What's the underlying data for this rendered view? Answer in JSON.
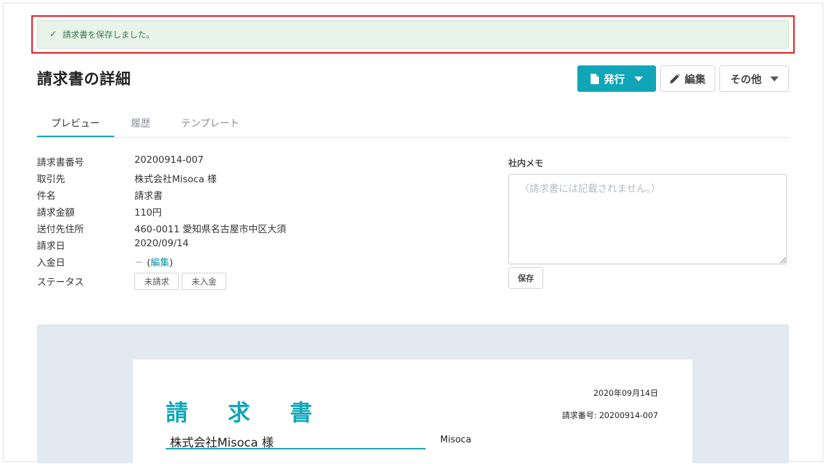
{
  "alert": {
    "icon": "check-icon",
    "message": "請求書を保存しました。"
  },
  "page": {
    "title": "請求書の詳細"
  },
  "toolbar": {
    "issue_label": "発行",
    "issue_icon": "document-icon",
    "edit_label": "編集",
    "edit_icon": "pencil-icon",
    "other_label": "その他"
  },
  "tabs": [
    {
      "label": "プレビュー",
      "active": true
    },
    {
      "label": "履歴",
      "active": false
    },
    {
      "label": "テンプレート",
      "active": false
    }
  ],
  "details": {
    "invoice_number": {
      "label": "請求書番号",
      "value": "20200914-007"
    },
    "client": {
      "label": "取引先",
      "value": "株式会社Misoca 様"
    },
    "subject": {
      "label": "件名",
      "value": "請求書"
    },
    "amount": {
      "label": "請求金額",
      "value": "110円"
    },
    "address": {
      "label": "送付先住所",
      "value": "460-0011 愛知県名古屋市中区大須"
    },
    "invoice_date": {
      "label": "請求日",
      "value": "2020/09/14"
    },
    "payment_date": {
      "label": "入金日",
      "dash": "－",
      "open": "(",
      "edit_link": "編集",
      "close": ")"
    },
    "status": {
      "label": "ステータス",
      "badges": [
        "未請求",
        "未入金"
      ]
    }
  },
  "memo": {
    "label": "社内メモ",
    "placeholder": "（請求書には記載されません。）",
    "save_label": "保存"
  },
  "preview": {
    "doc_title": "請 求 書",
    "date": "2020年09月14日",
    "number": "請求番号: 20200914-007",
    "client": "株式会社Misoca 様",
    "company": "Misoca"
  },
  "colors": {
    "accent": "#11a6b7",
    "alert_bg": "#e8f3ea",
    "alert_text": "#3e7a4f",
    "highlight": "#e01919"
  }
}
